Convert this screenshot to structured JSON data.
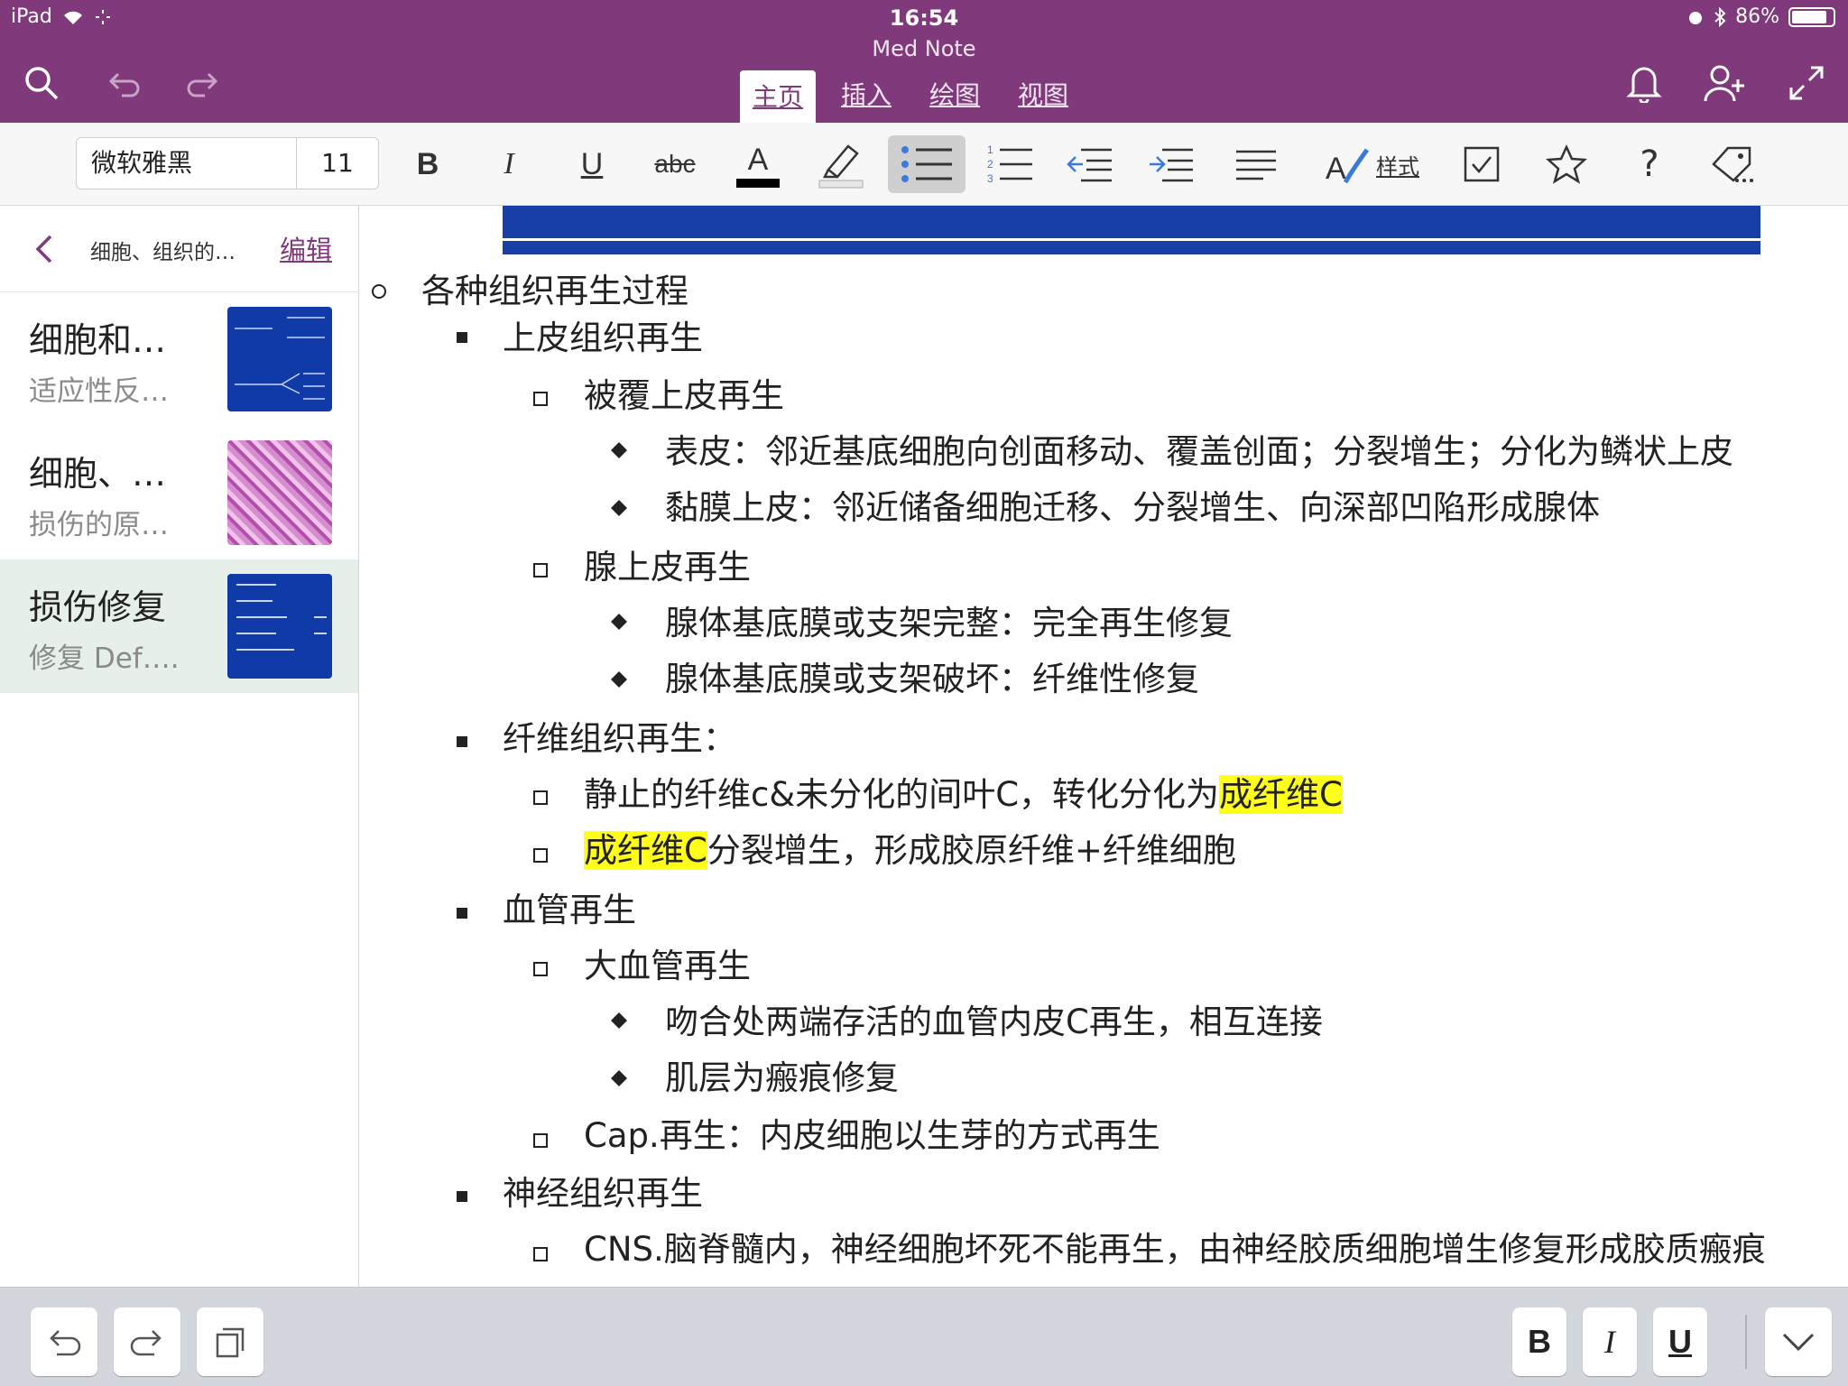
{
  "status_bar": {
    "device": "iPad",
    "time": "16:54",
    "battery": "86%",
    "battery_level": 0.86
  },
  "app": {
    "title": "Med Note"
  },
  "tabs": [
    {
      "label": "主页",
      "active": true
    },
    {
      "label": "插入",
      "active": false
    },
    {
      "label": "绘图",
      "active": false
    },
    {
      "label": "视图",
      "active": false
    }
  ],
  "toolbar": {
    "font_name": "微软雅黑",
    "font_size": "11",
    "styles_label": "样式",
    "help_label": "?"
  },
  "sidebar": {
    "breadcrumb": "细胞、组织的…",
    "edit_label": "编辑",
    "pages": [
      {
        "title": "细胞和…",
        "subtitle": "适应性反…"
      },
      {
        "title": "细胞、…",
        "subtitle": "损伤的原…"
      },
      {
        "title": "损伤修复",
        "subtitle": "修复  Def…."
      }
    ]
  },
  "note": {
    "heading": "各种组织再生过程",
    "epithelium": "上皮组织再生",
    "covering_epithelium": "被覆上皮再生",
    "epidermis": "表皮：邻近基底细胞向创面移动、覆盖创面；分裂增生；分化为鳞状上皮",
    "mucosa": "黏膜上皮：邻近储备细胞迁移、分裂增生、向深部凹陷形成腺体",
    "glandular": "腺上皮再生",
    "gland_intact": "腺体基底膜或支架完整：完全再生修复",
    "gland_broken": "腺体基底膜或支架破坏：纤维性修复",
    "fibrous": "纤维组织再生：",
    "fib1_a": "静止的纤维c&未分化的间叶C，转化分化为",
    "fib1_hl": "成纤维C",
    "fib2_hl": "成纤维C",
    "fib2_b": "分裂增生，形成胶原纤维+纤维细胞",
    "vessel": "血管再生",
    "large_vessel": "大血管再生",
    "anastomosis": "吻合处两端存活的血管内皮C再生，相互连接",
    "muscle": "肌层为瘢痕修复",
    "cap": "Cap.再生：内皮细胞以生芽的方式再生",
    "nerve": "神经组织再生",
    "cns": "CNS.脑脊髓内，神经细胞坏死不能再生，由神经胶质细胞增生修复形成胶质瘢痕"
  },
  "bottom_bar": {
    "bold": "B",
    "italic": "I",
    "underline": "U"
  },
  "colors": {
    "accent": "#80397b",
    "highlight": "#ffff1a",
    "banner": "#1640a8"
  }
}
